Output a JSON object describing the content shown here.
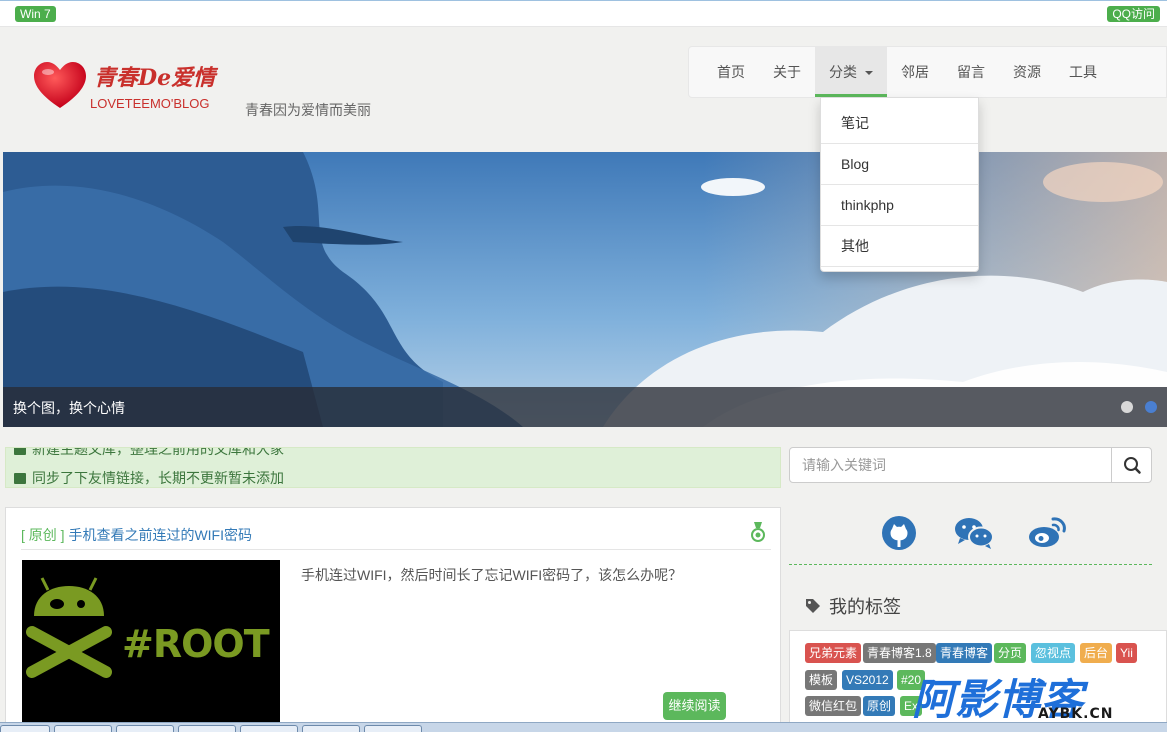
{
  "topbar": {
    "left_badge": "Win 7",
    "right_badge": "QQ访问"
  },
  "logo": {
    "title": "青春De爱情",
    "subtitle": "LOVETEEMO'BLOG",
    "icon": "heart-icon"
  },
  "slogan": "青春因为爱情而美丽",
  "nav": {
    "items": [
      {
        "label": "首页"
      },
      {
        "label": "关于"
      },
      {
        "label": "分类",
        "active": true
      },
      {
        "label": "邻居"
      },
      {
        "label": "留言"
      },
      {
        "label": "资源"
      },
      {
        "label": "工具"
      }
    ],
    "dropdown": [
      "笔记",
      "Blog",
      "thinkphp",
      "其他"
    ]
  },
  "banner": {
    "caption": "换个图，换个心情",
    "slide_count": 2,
    "active_slide": 2
  },
  "notice": {
    "line1": "新建主题文库，整理之前用的文库和大家",
    "line2": "同步了下友情链接，长期不更新暂未添加"
  },
  "search": {
    "placeholder": "请输入关键词",
    "icon": "search-icon"
  },
  "social": {
    "icons": [
      "github-icon",
      "wechat-icon",
      "weibo-icon"
    ]
  },
  "tags": {
    "title": "我的标签",
    "icon": "tag-icon",
    "items": [
      {
        "label": "兄弟元素",
        "color": "#d9534f"
      },
      {
        "label": "青春博客1.8",
        "color": "#777777"
      },
      {
        "label": "青春博客",
        "color": "#337ab7"
      },
      {
        "label": "分页",
        "color": "#5cb85c"
      },
      {
        "label": "忽视点",
        "color": "#5bc0de"
      },
      {
        "label": "后台",
        "color": "#f0ad4e"
      },
      {
        "label": "Yii",
        "color": "#d9534f"
      },
      {
        "label": "模板",
        "color": "#777777"
      },
      {
        "label": "VS2012",
        "color": "#337ab7"
      },
      {
        "label": "#20",
        "color": "#5cb85c"
      },
      {
        "label": "微信红包",
        "color": "#777777"
      },
      {
        "label": "原创",
        "color": "#337ab7"
      },
      {
        "label": "Ex",
        "color": "#5cb85c"
      }
    ]
  },
  "post": {
    "origin": "[ 原创 ]",
    "title": "手机查看之前连过的WIFI密码",
    "summary": "手机连过WIFI，然后时间长了忘记WIFI密码了，该怎么办呢？",
    "thumb_text": "#ROOT",
    "read_more": "继续阅读",
    "badge_icon": "medal-icon"
  },
  "watermark": {
    "text": "阿影博客",
    "domain": "AYBK.CN"
  }
}
